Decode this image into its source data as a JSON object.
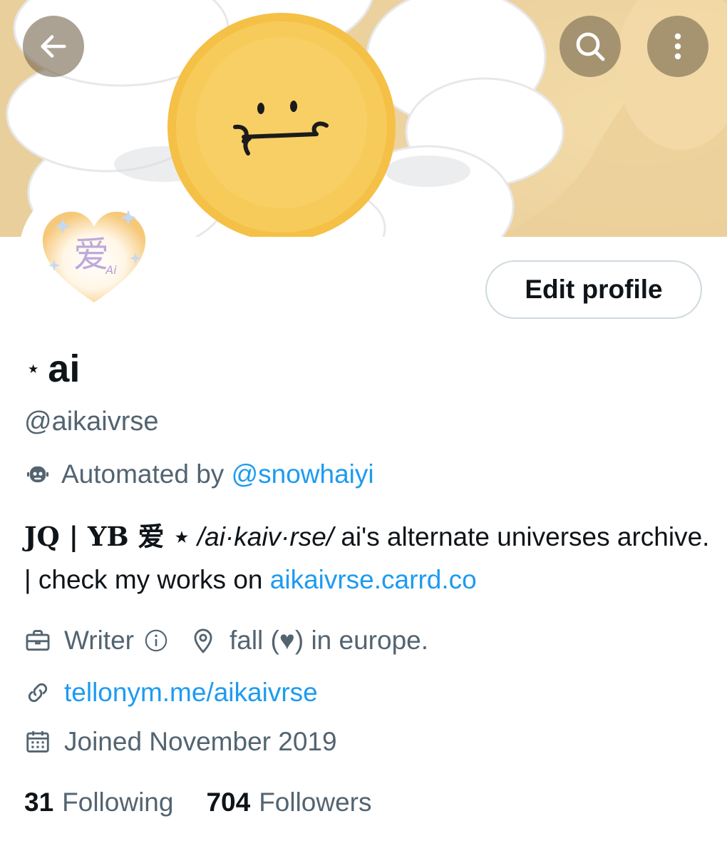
{
  "profile": {
    "display_name": "ai",
    "name_prefix_glyph": "⋆",
    "handle": "@aikaivrse",
    "automated_text": "Automated by",
    "automated_by": "@snowhaiyi",
    "bio": {
      "part1": "JQ | YB 爱 ⋆",
      "part2": "/ai·kaiv·rse/",
      "part3": " ai's alternate universes archive. | check my works on ",
      "link": "aikaivrse.carrd.co"
    },
    "category": "Writer",
    "location": "fall (♥) in europe.",
    "website": "tellonym.me/aikaivrse",
    "joined": "Joined November 2019",
    "following_count": "31",
    "following_label": "Following",
    "followers_count": "704",
    "followers_label": "Followers"
  },
  "buttons": {
    "edit_profile": "Edit profile"
  },
  "icons": {
    "back": "arrow-left-icon",
    "search": "search-icon",
    "more": "more-vertical-icon",
    "robot": "robot-icon",
    "briefcase": "briefcase-icon",
    "info": "info-icon",
    "location": "location-pin-icon",
    "link": "link-icon",
    "calendar": "calendar-icon"
  },
  "colors": {
    "link": "#1d9bf0",
    "secondary_text": "#536471",
    "primary_text": "#0f1419"
  }
}
